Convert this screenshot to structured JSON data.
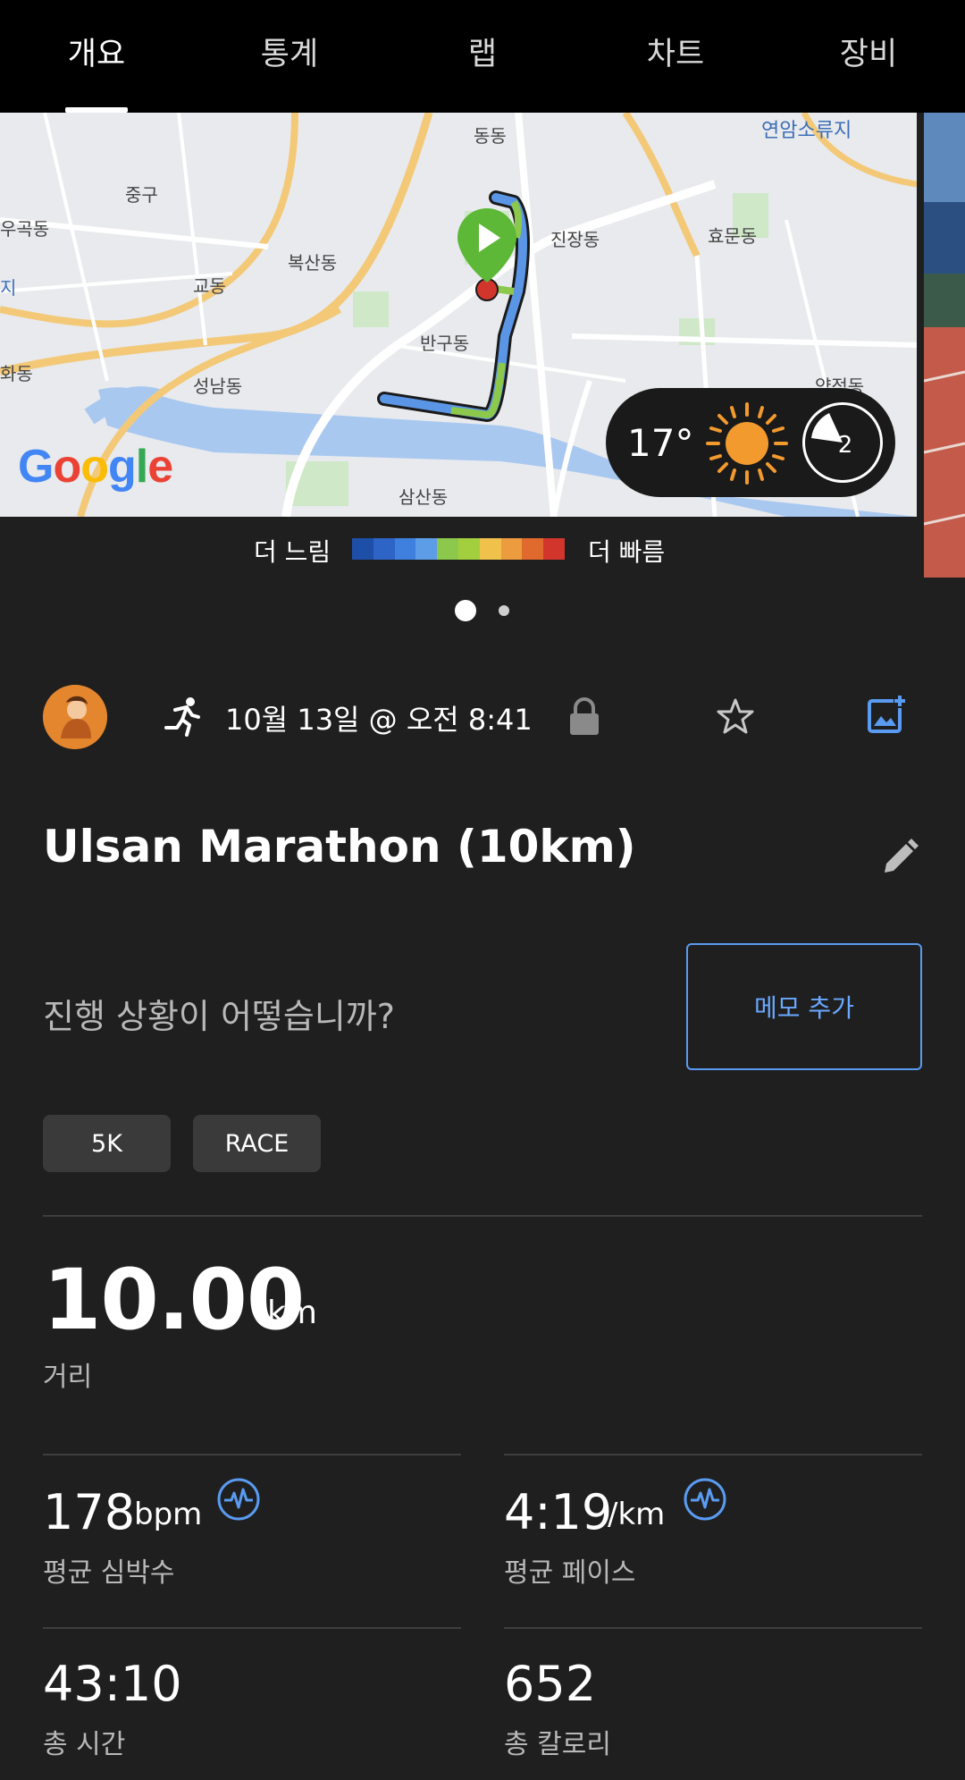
{
  "tabs": [
    {
      "label": "개요",
      "active": true
    },
    {
      "label": "통계",
      "active": false
    },
    {
      "label": "랩",
      "active": false
    },
    {
      "label": "차트",
      "active": false
    },
    {
      "label": "장비",
      "active": false
    }
  ],
  "map": {
    "labels": [
      "동동",
      "연암소류지",
      "중구",
      "우곡동",
      "진장동",
      "효문동",
      "복산동",
      "교동",
      "지",
      "반구동",
      "화동",
      "성남동",
      "양정동",
      "삼산동"
    ],
    "google_logo": "Google",
    "weather": {
      "temperature": "17°",
      "wind": "2",
      "icon": "sun-icon"
    }
  },
  "legend": {
    "slower": "더 느림",
    "faster": "더 빠름",
    "colors": [
      "#1e4fa8",
      "#2d64c6",
      "#3f80de",
      "#5d9de8",
      "#8cc84b",
      "#a3cf3f",
      "#f0c24c",
      "#ec9b3e",
      "#e06a2d",
      "#d2352b"
    ]
  },
  "pager": {
    "count": 2,
    "active": 0
  },
  "activity": {
    "date": "10월 13일 @ 오전 8:41",
    "title": "Ulsan Marathon (10km)",
    "prompt": "진행 상황이 어떻습니까?",
    "memo_button": "메모 추가",
    "tags": [
      "5K",
      "RACE"
    ]
  },
  "stats": {
    "distance": {
      "value": "10.00",
      "unit": "km",
      "label": "거리"
    },
    "heart_rate": {
      "value": "178",
      "unit": "bpm",
      "label": "평균 심박수"
    },
    "pace": {
      "value": "4:19",
      "unit": "/km",
      "label": "평균 페이스"
    },
    "time": {
      "value": "43:10",
      "label": "총 시간"
    },
    "calories": {
      "value": "652",
      "label": "총 칼로리"
    }
  },
  "colors": {
    "accent": "#5a9bf2",
    "background": "#1f1f1f",
    "tabbar": "#000000",
    "avatar": "#e3862d"
  }
}
